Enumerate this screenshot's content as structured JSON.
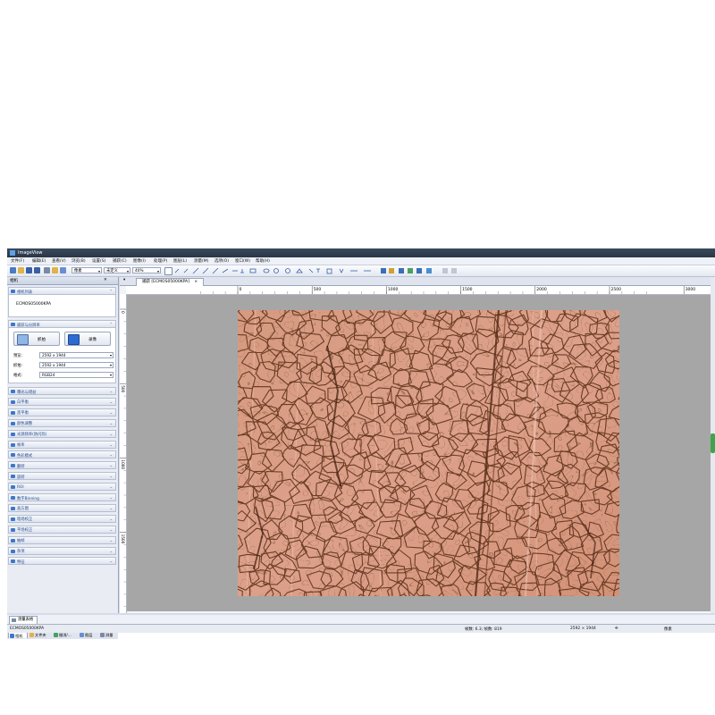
{
  "window": {
    "title": "ImageView"
  },
  "menu": [
    "文件(F)",
    "编辑(E)",
    "查看(V)",
    "浏览(B)",
    "设置(S)",
    "捕获(C)",
    "图像(I)",
    "处理(P)",
    "图层(L)",
    "测量(M)",
    "选项(O)",
    "窗口(W)",
    "帮助(H)"
  ],
  "toolbar": {
    "unit_value": "像素",
    "calib_value": "未定义",
    "zoom_value": "40%"
  },
  "left_panel": {
    "title": "相机",
    "camera_list_header": "相机列表",
    "camera_name": "ECMOS05000KPA",
    "capture_header": "捕获与分辨率",
    "snap_label": "抓拍",
    "record_label": "录像",
    "preview_label": "预览:",
    "preview_value": "2592 x 1944",
    "snap_res_label": "抓拍:",
    "snap_res_value": "2592 x 1944",
    "format_label": "格式:",
    "format_value": "RGB24",
    "sections": [
      "曝光与增益",
      "白平衡",
      "黑平衡",
      "颜色调整",
      "光源频率(防闪烁)",
      "帧率",
      "色彩模式",
      "翻转",
      "旋转",
      "ROI",
      "数字Binning",
      "直方图",
      "暗场校正",
      "平场校正",
      "抽帧",
      "杂项",
      "特征"
    ],
    "bottom_tabs": [
      "相机",
      "文件夹",
      "撤消/...",
      "图层",
      "测量"
    ]
  },
  "image_tab": {
    "label": "捕获 [ECMOS05000KPA]"
  },
  "ruler": {
    "h_ticks": [
      "0",
      "500",
      "1000",
      "1500",
      "2000",
      "2500",
      "3000"
    ],
    "v_ticks": [
      "0",
      "500",
      "1000",
      "1500"
    ]
  },
  "bottom_panel": {
    "tab": "测量表格"
  },
  "status": {
    "camera": "ECMOS05000KPA",
    "fps": "帧数: 6.3; 帧数: 819",
    "resolution": "2592 × 1944",
    "pixel_unit": "像素"
  },
  "colors": {
    "accent": "#3f77c8",
    "section_text": "#2a4f93",
    "canvas_bg": "#a6a6a6",
    "image_base": "#d99a80",
    "crack_color": "#5a2d16"
  }
}
